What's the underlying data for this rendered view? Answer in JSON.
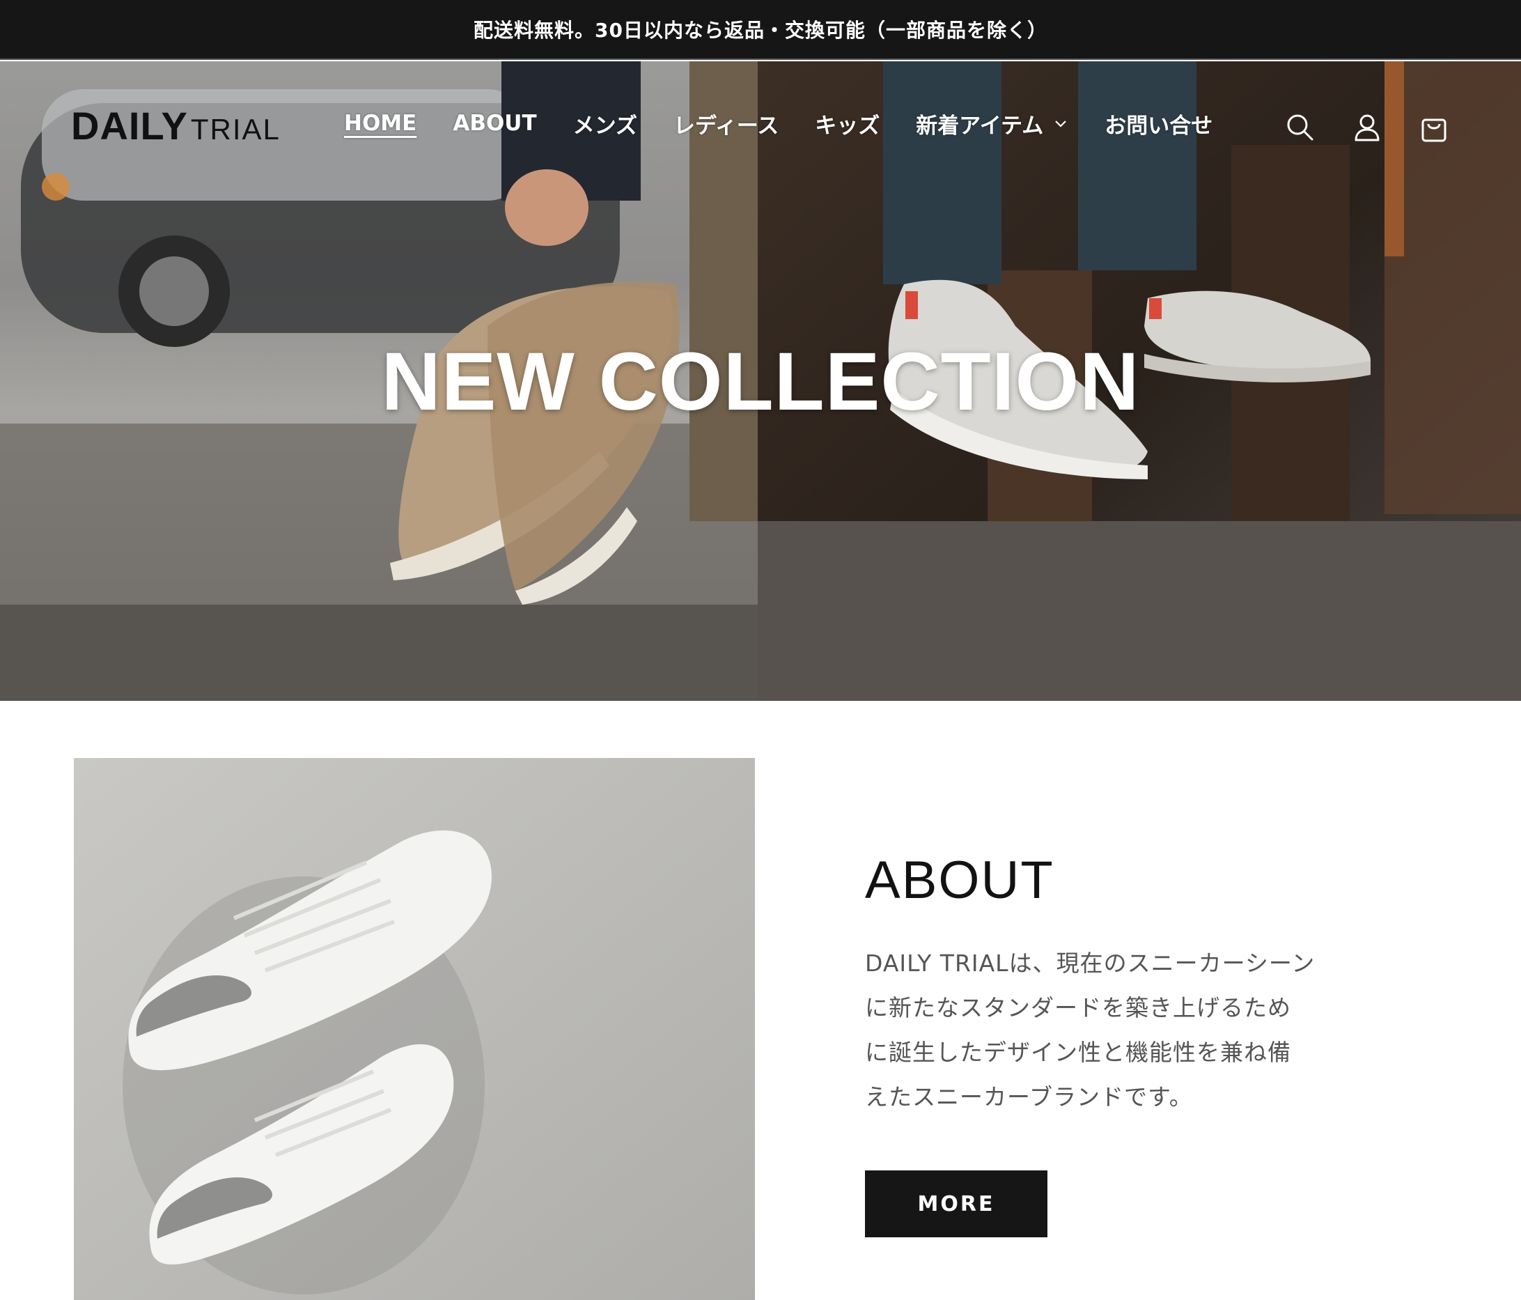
{
  "announcement": {
    "text": "配送料無料。30日以内なら返品・交換可能（一部商品を除く）"
  },
  "header": {
    "logo_strong": "DAILY",
    "logo_light": "TRIAL",
    "nav": [
      {
        "label": "HOME",
        "active": true
      },
      {
        "label": "ABOUT",
        "active": false
      },
      {
        "label": "メンズ",
        "active": false
      },
      {
        "label": "レディース",
        "active": false
      },
      {
        "label": "キッズ",
        "active": false
      },
      {
        "label": "新着アイテム",
        "active": false,
        "has_dropdown": true
      },
      {
        "label": "お問い合せ",
        "active": false
      }
    ],
    "icons": [
      "search-icon",
      "account-icon",
      "cart-icon"
    ]
  },
  "hero": {
    "title": "NEW COLLECTION"
  },
  "about": {
    "heading": "ABOUT",
    "body_lines": [
      "DAILY TRIALは、現在のスニーカーシーン",
      "に新たなスタンダードを築き上げるため",
      "に誕生したデザイン性と機能性を兼ね備",
      "えたスニーカーブランドです。"
    ],
    "button_label": "MORE"
  },
  "colors": {
    "announcement_bg": "#161616",
    "button_bg": "#161616",
    "body_text": "#555555",
    "white": "#ffffff"
  }
}
